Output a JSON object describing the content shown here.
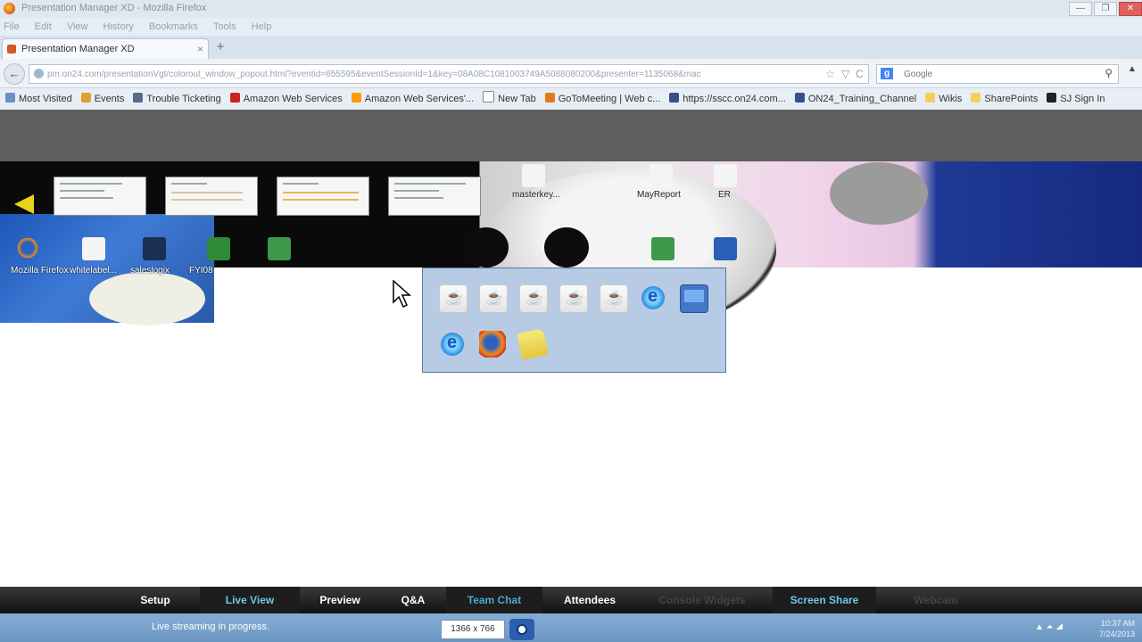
{
  "window": {
    "title": "Presentation Manager XD - Mozilla Firefox",
    "minimize_label": "—",
    "maximize_label": "❐",
    "close_label": "✕"
  },
  "menubar": [
    "File",
    "Edit",
    "View",
    "History",
    "Bookmarks",
    "Tools",
    "Help"
  ],
  "tab": {
    "label": "Presentation Manager XD",
    "close_label": "×",
    "new_tab_label": "+"
  },
  "navbar": {
    "back_label": "←",
    "url": "pm.on24.com/presentationVgt/colorout_window_popout.html?eventid=655595&eventSessionId=1&key=08A08C1081003749A5088080200&presenter=1135068&mac",
    "search_placeholder": "Google",
    "search_label": "g",
    "star_label": "☆",
    "reload_label": "C",
    "dropdown_label": "▽",
    "search_btn_label": "⚲",
    "menu_label": "▲"
  },
  "bookmarks": [
    {
      "label": "Most Visited",
      "color": "#6b8fc7"
    },
    {
      "label": "Events",
      "color": "#e0a030"
    },
    {
      "label": "Trouble Ticketing",
      "color": "#5a6a8a"
    },
    {
      "label": "Amazon Web Services",
      "color": "#cc2222"
    },
    {
      "label": "Amazon Web Services'...",
      "color": "#ff9900"
    },
    {
      "label": "New Tab",
      "color": "#ffffff"
    },
    {
      "label": "GoToMeeting | Web c...",
      "color": "#e37a1c"
    },
    {
      "label": "https://sscc.on24.com...",
      "color": "#3a4f8a"
    },
    {
      "label": "ON24_Training_Channel",
      "color": "#3a4f8a"
    },
    {
      "label": "Wikis",
      "color": "#f2d15a"
    },
    {
      "label": "SharePoints",
      "color": "#f2d15a"
    },
    {
      "label": "SJ Sign In",
      "color": "#222222"
    }
  ],
  "desktop": {
    "icons": [
      "Mozilla Firefox",
      "whitelabel...",
      "saleslogix",
      "FYI08",
      "masterkey...",
      "MayReport",
      "ER"
    ]
  },
  "popup": {
    "icons": [
      "java-icon",
      "java-icon",
      "java-icon",
      "java-icon",
      "java-icon",
      "ie-icon",
      "monitor-icon",
      "ie-icon",
      "firefox-icon",
      "folder-icon"
    ]
  },
  "bottom_nav": [
    {
      "label": "Setup",
      "color": "#ffffff"
    },
    {
      "label": "Live View",
      "color": "#6fc7e8"
    },
    {
      "label": "Preview",
      "color": "#ffffff"
    },
    {
      "label": "Q&A",
      "color": "#ffffff"
    },
    {
      "label": "Team Chat",
      "color": "#4fa6cf"
    },
    {
      "label": "Attendees",
      "color": "#ffffff"
    },
    {
      "label": "Console Widgets",
      "color": "#444444"
    },
    {
      "label": "Screen Share",
      "color": "#6fc7e8"
    },
    {
      "label": "Webcam",
      "color": "#444444"
    }
  ],
  "status": {
    "text": "Live streaming in progress.",
    "resolution": "1366 x 766"
  },
  "clock": {
    "time": "10:37 AM",
    "date": "7/24/2013"
  }
}
